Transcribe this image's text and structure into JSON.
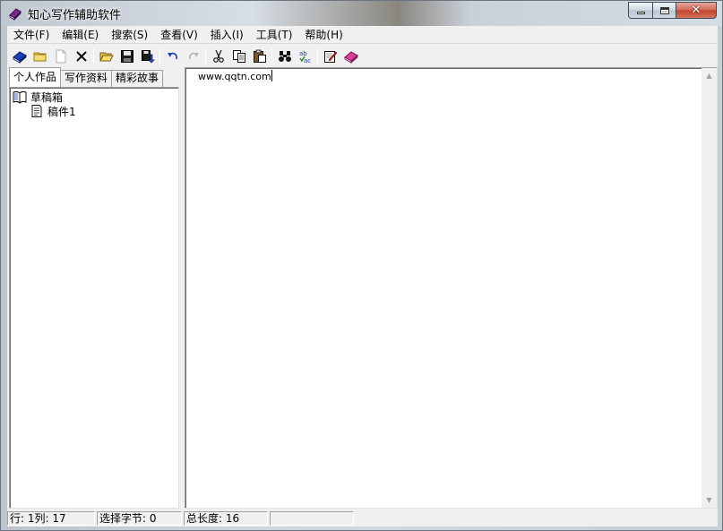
{
  "window": {
    "title": "知心写作辅助软件",
    "caption": {
      "minimize": "minimize",
      "maximize": "maximize",
      "close": "✕"
    }
  },
  "menubar": {
    "items": [
      "文件(F)",
      "编辑(E)",
      "搜索(S)",
      "查看(V)",
      "插入(I)",
      "工具(T)",
      "帮助(H)"
    ]
  },
  "toolbar": {
    "buttons": [
      "book-icon",
      "new-folder-icon",
      "new-document-icon",
      "delete-icon",
      "open-folder-icon",
      "save-icon",
      "export-icon",
      "undo-icon",
      "redo-icon",
      "cut-icon",
      "copy-icon",
      "paste-icon",
      "find-icon",
      "spellcheck-icon",
      "edit-notes-icon",
      "help-book-icon"
    ]
  },
  "left_pane": {
    "tabs": [
      "个人作品",
      "写作资料",
      "精彩故事"
    ],
    "active_tab": 0,
    "tree": {
      "root": "草稿箱",
      "children": [
        "稿件1"
      ]
    }
  },
  "editor": {
    "content": "www.qqtn.com"
  },
  "statusbar": {
    "position": "行: 1列: 17",
    "selection": "选择字节: 0",
    "total_length": "总长度: 16",
    "extra": ""
  },
  "colors": {
    "chrome": "#f0f0f0",
    "border": "#a0a0a0",
    "close_button": "#c1452d"
  }
}
